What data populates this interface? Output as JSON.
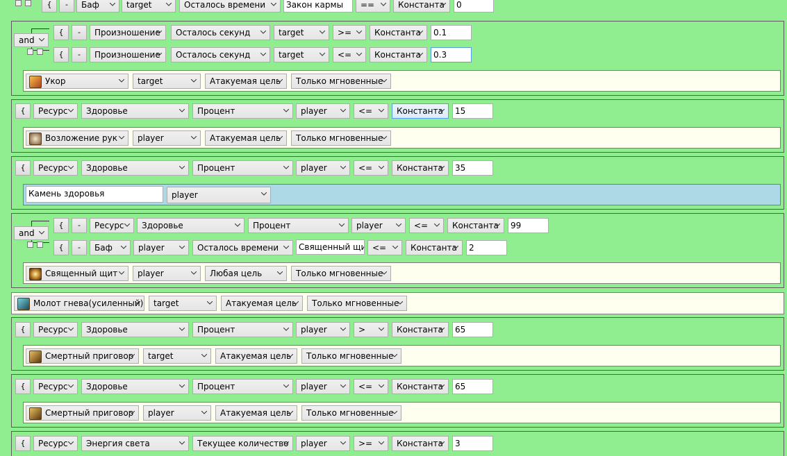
{
  "rows": {
    "r0": {
      "open": "{",
      "minus": "-",
      "type": "Баф",
      "unit": "target",
      "param": "Осталось времени",
      "name": "Закон кармы",
      "op": "==",
      "kind": "Константа",
      "value": "0"
    },
    "b1": {
      "and": "and",
      "c1": {
        "open": "{",
        "minus": "-",
        "type": "Произношение",
        "param": "Осталось секунд",
        "unit": "target",
        "op": ">=",
        "kind": "Константа",
        "value": "0.1"
      },
      "c2": {
        "open": "{",
        "minus": "-",
        "type": "Произношение",
        "param": "Осталось секунд",
        "unit": "target",
        "op": "<=",
        "kind": "Константа",
        "value": "0.3"
      },
      "action": {
        "spell": "Укор",
        "unit": "target",
        "targeting": "Атакуемая цель",
        "cast": "Только мгновенные"
      }
    },
    "b2": {
      "c1": {
        "open": "{",
        "type": "Ресурс",
        "res": "Здоровье",
        "mode": "Процент",
        "unit": "player",
        "op": "<=",
        "kind": "Константа",
        "value": "15"
      },
      "action": {
        "spell": "Возложение рук",
        "unit": "player",
        "targeting": "Атакуемая цель",
        "cast": "Только мгновенные"
      }
    },
    "b3": {
      "c1": {
        "open": "{",
        "type": "Ресурс",
        "res": "Здоровье",
        "mode": "Процент",
        "unit": "player",
        "op": "<=",
        "kind": "Константа",
        "value": "35"
      },
      "action": {
        "item": "Камень здоровья",
        "unit": "player"
      }
    },
    "b4": {
      "and": "and",
      "c1": {
        "open": "{",
        "minus": "-",
        "type": "Ресурс",
        "res": "Здоровье",
        "mode": "Процент",
        "unit": "player",
        "op": "<=",
        "kind": "Константа",
        "value": "99"
      },
      "c2": {
        "open": "{",
        "minus": "-",
        "type": "Баф",
        "unit": "player",
        "param": "Осталось времени",
        "name": "Священный щит",
        "op": "<=",
        "kind": "Константа",
        "value": "2"
      },
      "action": {
        "spell": "Священный щит",
        "unit": "player",
        "targeting": "Любая цель",
        "cast": "Только мгновенные"
      }
    },
    "b5": {
      "action": {
        "spell": "Молот гнева(усиленный)",
        "unit": "target",
        "targeting": "Атакуемая цель",
        "cast": "Только мгновенные"
      }
    },
    "b6": {
      "c1": {
        "open": "{",
        "type": "Ресурс",
        "res": "Здоровье",
        "mode": "Процент",
        "unit": "player",
        "op": ">",
        "kind": "Константа",
        "value": "65"
      },
      "action": {
        "spell": "Смертный приговор",
        "unit": "target",
        "targeting": "Атакуемая цель",
        "cast": "Только мгновенные"
      }
    },
    "b7": {
      "c1": {
        "open": "{",
        "type": "Ресурс",
        "res": "Здоровье",
        "mode": "Процент",
        "unit": "player",
        "op": "<=",
        "kind": "Константа",
        "value": "65"
      },
      "action": {
        "spell": "Смертный приговор",
        "unit": "player",
        "targeting": "Атакуемая цель",
        "cast": "Только мгновенные"
      }
    },
    "b8": {
      "c1": {
        "open": "{",
        "type": "Ресурс",
        "res": "Энергия света",
        "mode": "Текущее количество",
        "unit": "player",
        "op": ">=",
        "kind": "Константа",
        "value": "3"
      }
    }
  },
  "colors": {
    "background": "#90ee90",
    "action_bg": "#fffff0",
    "item_bg": "#add8e6",
    "focus": "#569de5"
  },
  "icons": [
    "chevron-down-icon",
    "spell-rebuke-icon",
    "spell-lay-on-hands-icon",
    "spell-sacred-shield-icon",
    "spell-hammer-of-wrath-icon",
    "spell-execution-sentence-icon"
  ]
}
